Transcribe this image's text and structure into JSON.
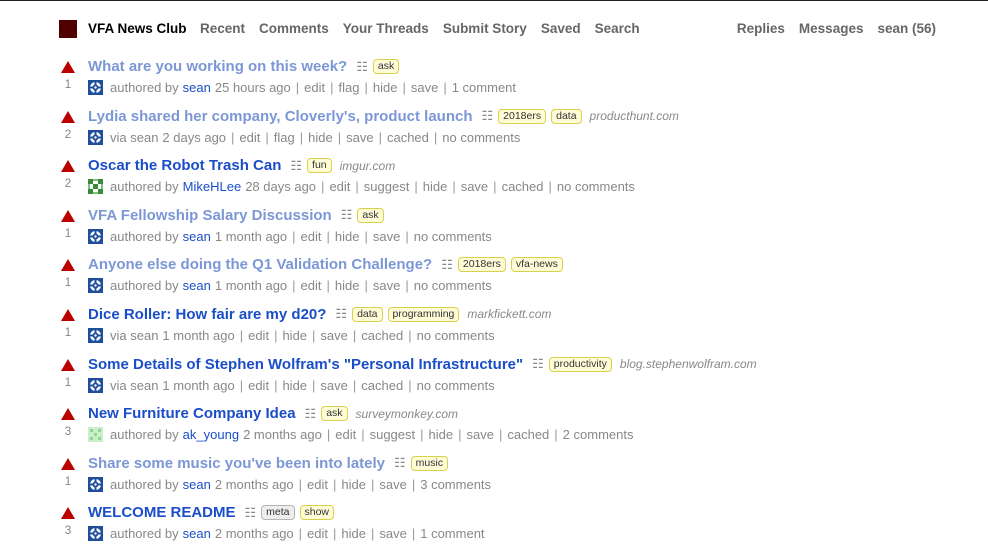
{
  "header": {
    "site_name": "VFA News Club",
    "nav_left": [
      "Recent",
      "Comments",
      "Your Threads",
      "Submit Story",
      "Saved",
      "Search"
    ],
    "nav_right": [
      "Replies",
      "Messages",
      "sean (56)"
    ]
  },
  "colors": {
    "logo": "#500000",
    "upvote": "#bb0000",
    "link_unread": "#1a4ec9",
    "link_read": "#7c97d6",
    "tag_bg": "#fffcd7"
  },
  "stories": [
    {
      "score": "1",
      "title": "What are you working on this week?",
      "read": true,
      "tags": [
        {
          "label": "ask",
          "kind": "normal"
        }
      ],
      "domain": "",
      "prefix": "authored by",
      "author": "sean",
      "age": "25 hours ago",
      "actions": [
        "edit",
        "flag",
        "hide",
        "save",
        "1 comment"
      ],
      "avatar": "sean-avatar"
    },
    {
      "score": "2",
      "title": "Lydia shared her company, Cloverly's, product launch",
      "read": true,
      "tags": [
        {
          "label": "2018ers",
          "kind": "normal"
        },
        {
          "label": "data",
          "kind": "normal"
        }
      ],
      "domain": "producthunt.com",
      "prefix": "via sean",
      "author": "",
      "age": "2 days ago",
      "actions": [
        "edit",
        "flag",
        "hide",
        "save",
        "cached",
        "no comments"
      ],
      "avatar": "sean-avatar"
    },
    {
      "score": "2",
      "title": "Oscar the Robot Trash Can",
      "read": false,
      "tags": [
        {
          "label": "fun",
          "kind": "normal"
        }
      ],
      "domain": "imgur.com",
      "prefix": "authored by",
      "author": "MikeHLee",
      "age": "28 days ago",
      "actions": [
        "edit",
        "suggest",
        "hide",
        "save",
        "cached",
        "no comments"
      ],
      "avatar": "mikehlee-avatar"
    },
    {
      "score": "1",
      "title": "VFA Fellowship Salary Discussion",
      "read": true,
      "tags": [
        {
          "label": "ask",
          "kind": "normal"
        }
      ],
      "domain": "",
      "prefix": "authored by",
      "author": "sean",
      "age": "1 month ago",
      "actions": [
        "edit",
        "hide",
        "save",
        "no comments"
      ],
      "avatar": "sean-avatar"
    },
    {
      "score": "1",
      "title": "Anyone else doing the Q1 Validation Challenge?",
      "read": true,
      "tags": [
        {
          "label": "2018ers",
          "kind": "normal"
        },
        {
          "label": "vfa-news",
          "kind": "normal"
        }
      ],
      "domain": "",
      "prefix": "authored by",
      "author": "sean",
      "age": "1 month ago",
      "actions": [
        "edit",
        "hide",
        "save",
        "no comments"
      ],
      "avatar": "sean-avatar"
    },
    {
      "score": "1",
      "title": "Dice Roller: How fair are my d20?",
      "read": false,
      "tags": [
        {
          "label": "data",
          "kind": "normal"
        },
        {
          "label": "programming",
          "kind": "normal"
        }
      ],
      "domain": "markfickett.com",
      "prefix": "via sean",
      "author": "",
      "age": "1 month ago",
      "actions": [
        "edit",
        "hide",
        "save",
        "cached",
        "no comments"
      ],
      "avatar": "sean-avatar"
    },
    {
      "score": "1",
      "title": "Some Details of Stephen Wolfram's \"Personal Infrastructure\"",
      "read": false,
      "tags": [
        {
          "label": "productivity",
          "kind": "normal"
        }
      ],
      "domain": "blog.stephenwolfram.com",
      "prefix": "via sean",
      "author": "",
      "age": "1 month ago",
      "actions": [
        "edit",
        "hide",
        "save",
        "cached",
        "no comments"
      ],
      "avatar": "sean-avatar"
    },
    {
      "score": "3",
      "title": "New Furniture Company Idea",
      "read": false,
      "tags": [
        {
          "label": "ask",
          "kind": "normal"
        }
      ],
      "domain": "surveymonkey.com",
      "prefix": "authored by",
      "author": "ak_young",
      "age": "2 months ago",
      "actions": [
        "edit",
        "suggest",
        "hide",
        "save",
        "cached",
        "2 comments"
      ],
      "avatar": "akyoung-avatar"
    },
    {
      "score": "1",
      "title": "Share some music you've been into lately",
      "read": true,
      "tags": [
        {
          "label": "music",
          "kind": "normal"
        }
      ],
      "domain": "",
      "prefix": "authored by",
      "author": "sean",
      "age": "2 months ago",
      "actions": [
        "edit",
        "hide",
        "save",
        "3 comments"
      ],
      "avatar": "sean-avatar"
    },
    {
      "score": "3",
      "title": "WELCOME README",
      "read": false,
      "tags": [
        {
          "label": "meta",
          "kind": "meta"
        },
        {
          "label": "show",
          "kind": "normal"
        }
      ],
      "domain": "",
      "prefix": "authored by",
      "author": "sean",
      "age": "2 months ago",
      "actions": [
        "edit",
        "hide",
        "save",
        "1 comment"
      ],
      "avatar": "sean-avatar"
    }
  ]
}
